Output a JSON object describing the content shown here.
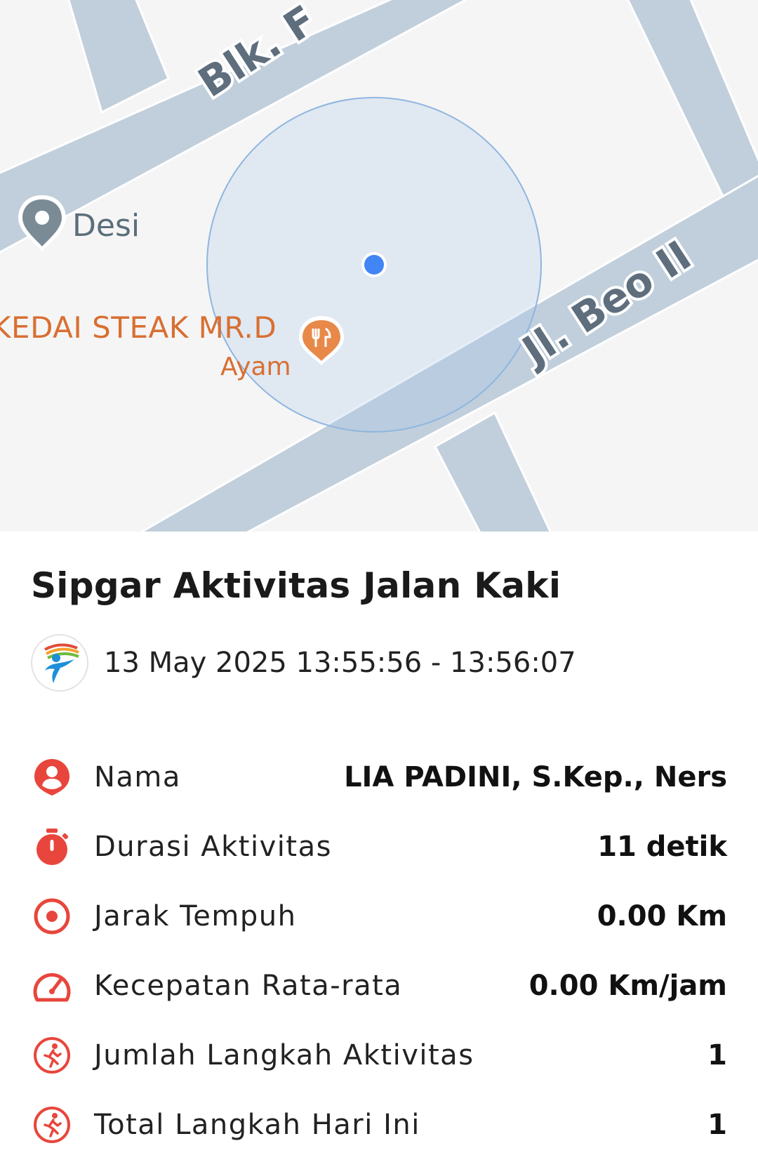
{
  "map": {
    "road_labels": [
      "Blk. F",
      "Jl. Beo II"
    ],
    "pois": [
      {
        "name": "Desi",
        "icon": "map-pin-icon"
      },
      {
        "name": "KEDAI STEAK MR.D",
        "subtitle": "Ayam",
        "icon": "restaurant-icon"
      }
    ],
    "colors": {
      "road": "#c1cfdc",
      "background": "#f5f5f5",
      "accuracy_circle": "#a9c7e8",
      "location_dot": "#4285f4",
      "restaurant": "#e8894a"
    }
  },
  "activity": {
    "title": "Sipgar Aktivitas Jalan Kaki",
    "datetime": "13 May 2025 13:55:56 - 13:56:07"
  },
  "stats": [
    {
      "label": "Nama",
      "value": "LIA PADINI, S.Kep., Ners",
      "icon": "user-pin-icon"
    },
    {
      "label": "Durasi Aktivitas",
      "value": "11 detik",
      "icon": "stopwatch-icon"
    },
    {
      "label": "Jarak Tempuh",
      "value": "0.00 Km",
      "icon": "target-icon"
    },
    {
      "label": "Kecepatan Rata-rata",
      "value": "0.00 Km/jam",
      "icon": "speedometer-icon"
    },
    {
      "label": "Jumlah Langkah Aktivitas",
      "value": "1",
      "icon": "walking-icon"
    },
    {
      "label": "Total Langkah Hari Ini",
      "value": "1",
      "icon": "walking-icon"
    }
  ],
  "accent_color": "#e8463c"
}
